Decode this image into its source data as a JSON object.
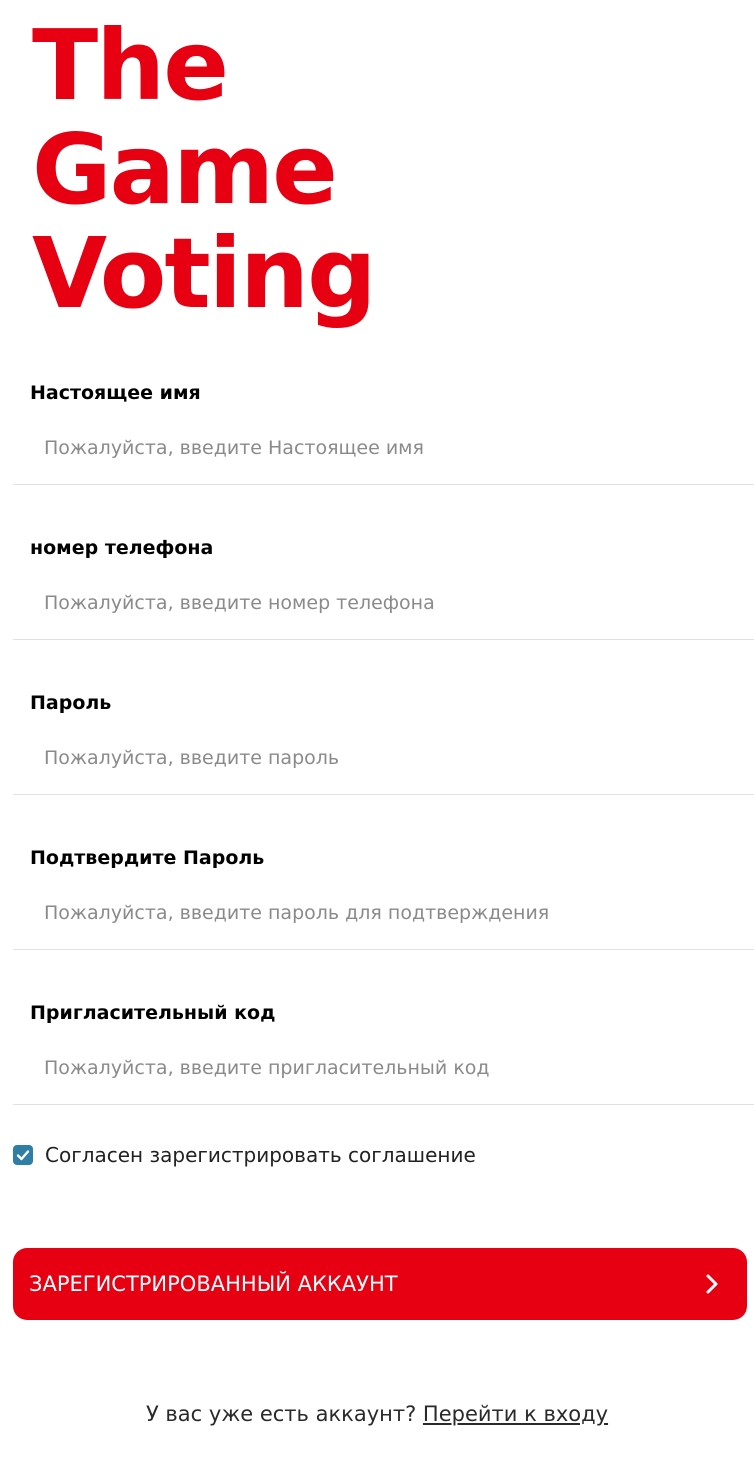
{
  "brand": {
    "line1": "The",
    "line2": "Game",
    "line3": "Voting",
    "color": "#e60012"
  },
  "form": {
    "fields": [
      {
        "label": "Настоящее имя",
        "value": "",
        "placeholder": "Пожалуйста, введите Настоящее имя"
      },
      {
        "label": "номер телефона",
        "value": "",
        "placeholder": "Пожалуйста, введите номер телефона"
      },
      {
        "label": "Пароль",
        "value": "",
        "placeholder": "Пожалуйста, введите пароль"
      },
      {
        "label": "Подтвердите Пароль",
        "value": "",
        "placeholder": "Пожалуйста, введите пароль для подтверждения"
      },
      {
        "label": "Пригласительный код",
        "value": "",
        "placeholder": "Пожалуйста, введите пригласительный код"
      }
    ],
    "agreement": {
      "checked": true,
      "label": "Согласен зарегистрировать соглашение"
    },
    "submit": {
      "label": "ЗАРЕГИСТРИРОВАННЫЙ АККАУНТ",
      "icon": "chevron-right-icon"
    }
  },
  "footer": {
    "prompt": "У вас уже есть аккаунт?",
    "link": "Перейти к входу"
  },
  "colors": {
    "accent": "#e60012",
    "checkbox": "#2f7ea5"
  }
}
